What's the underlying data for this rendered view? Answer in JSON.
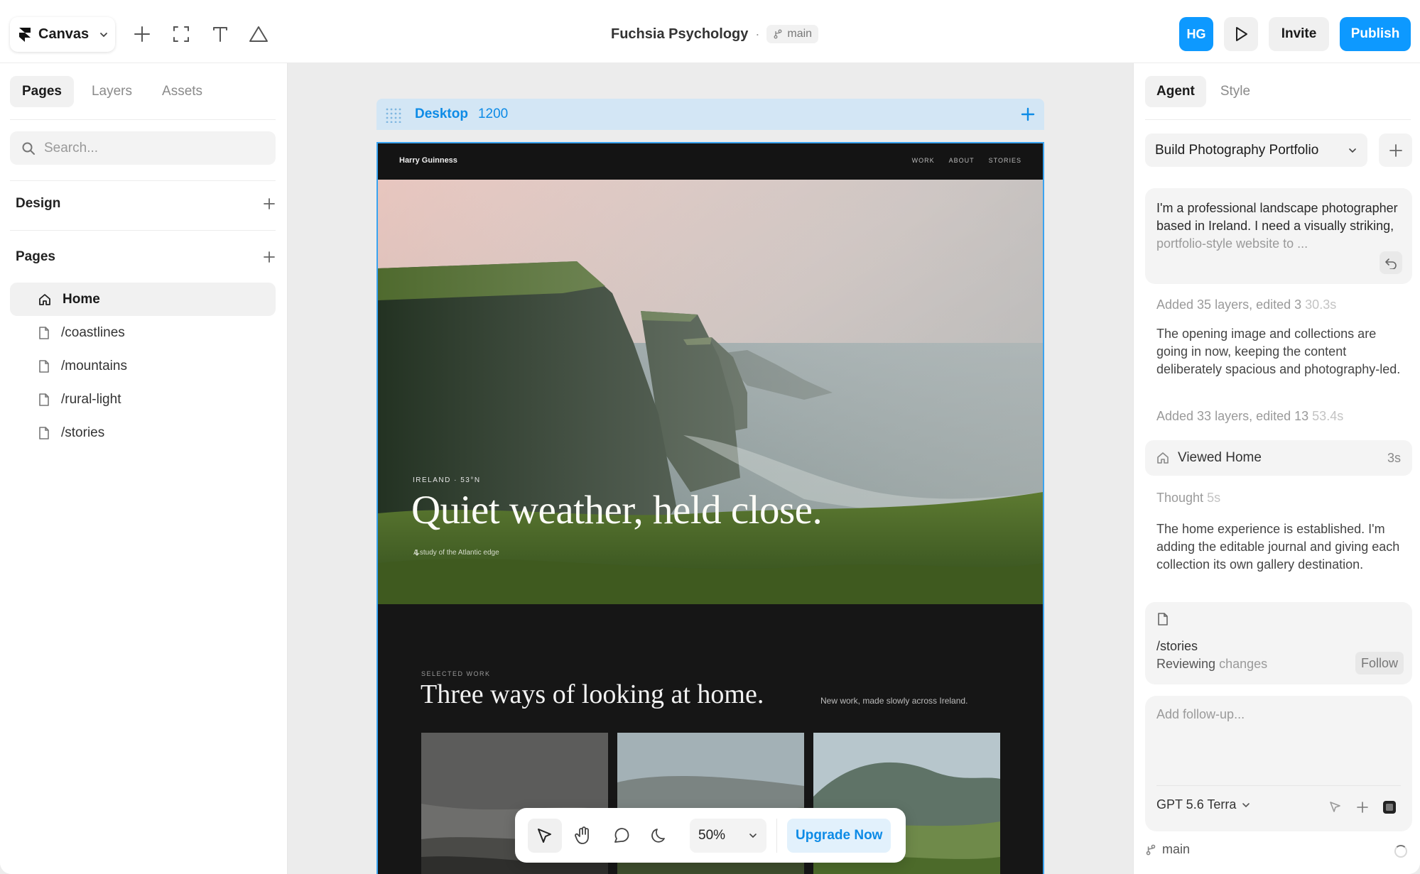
{
  "topbar": {
    "app_name": "Canvas",
    "project_title": "Fuchsia Psychology",
    "branch": "main",
    "avatar_initials": "HG",
    "invite_label": "Invite",
    "publish_label": "Publish",
    "tools": [
      "plus-icon",
      "frame-icon",
      "text-icon",
      "shape-icon"
    ]
  },
  "left": {
    "tabs": [
      "Pages",
      "Layers",
      "Assets"
    ],
    "active_tab": "Pages",
    "search_placeholder": "Search...",
    "design_label": "Design",
    "pages_label": "Pages",
    "pages": [
      {
        "name": "Home",
        "icon": "home-icon",
        "active": true
      },
      {
        "name": "/coastlines",
        "icon": "file-icon"
      },
      {
        "name": "/mountains",
        "icon": "file-icon"
      },
      {
        "name": "/rural-light",
        "icon": "file-icon"
      },
      {
        "name": "/stories",
        "icon": "file-icon"
      }
    ]
  },
  "canvas": {
    "frame_name": "Desktop",
    "frame_width": "1200",
    "site": {
      "name": "Harry Guinness",
      "nav": [
        "WORK",
        "ABOUT",
        "STORIES"
      ],
      "hero_eyebrow": "IRELAND · 53°N",
      "hero_title": "Quiet weather, held close.",
      "hero_sub": "A study of the Atlantic edge",
      "work_eyebrow": "SELECTED WORK",
      "work_title": "Three ways of looking at home.",
      "work_note": "New work, made slowly across Ireland."
    },
    "toolbar": {
      "zoom": "50%",
      "upgrade_label": "Upgrade Now",
      "icons": [
        "pointer-icon",
        "hand-icon",
        "comment-icon",
        "moon-icon"
      ]
    }
  },
  "right": {
    "tabs": [
      "Agent",
      "Style"
    ],
    "active_tab": "Agent",
    "conversation": "Build Photography Portfolio",
    "prompt_text": "I'm a professional landscape photographer based in Ireland. I need a visually striking,",
    "prompt_fade": "portfolio-style website to ...",
    "log1": {
      "text": "Added 35 layers, edited 3",
      "time": "30.3s"
    },
    "msg1": "The opening image and collections are going in now, keeping the content deliberately spacious and photography-led.",
    "log2": {
      "text": "Added 33 layers, edited 13",
      "time": "53.4s"
    },
    "viewed": {
      "label": "Viewed Home",
      "time": "3s"
    },
    "thought": {
      "label": "Thought",
      "time": "5s"
    },
    "msg2": "The home experience is established. I'm adding the editable journal and giving each collection its own gallery destination.",
    "file_card": {
      "path": "/stories",
      "status_a": "Reviewing",
      "status_b": "changes",
      "follow_label": "Follow"
    },
    "compose_placeholder": "Add follow-up...",
    "model": "GPT 5.6 Terra",
    "branch": "main"
  },
  "colors": {
    "accent": "#0d99ff",
    "frame_border": "#3aa3f0",
    "site_bg": "#141414"
  }
}
